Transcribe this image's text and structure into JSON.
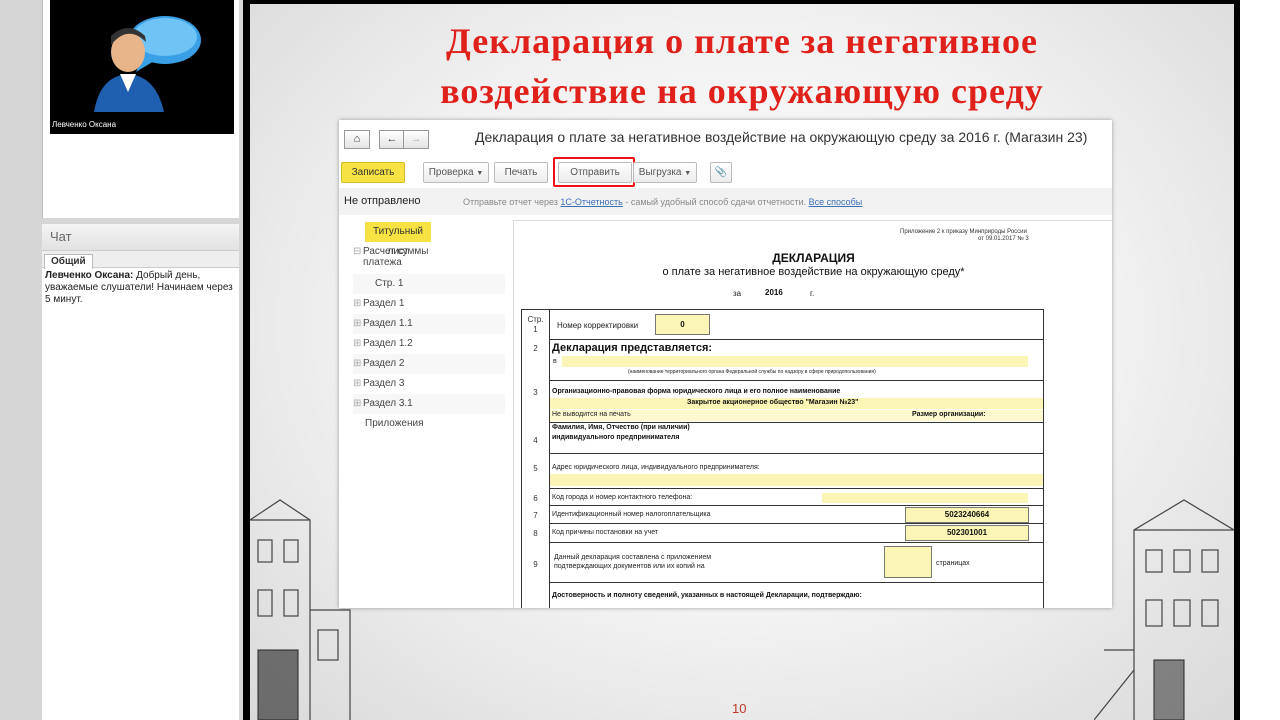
{
  "webinar": {
    "presenter_name": "Левченко Оксана",
    "chat": {
      "title": "Чат",
      "tab": "Общий",
      "message_author": "Левченко Оксана:",
      "message_text": "Добрый день, уважаемые слушатели! Начинаем через 5 минут."
    }
  },
  "slide": {
    "title_line1": "Декларация о плате за негативное",
    "title_line2": "воздействие на окружающую среду",
    "page_number": "10"
  },
  "app": {
    "window_title": "Декларация о плате за негативное воздействие на окружающую среду за 2016 г. (Магазин 23)",
    "toolbar": {
      "save": "Записать",
      "check": "Проверка",
      "print": "Печать",
      "send": "Отправить",
      "export": "Выгрузка",
      "clip_icon": "paperclip-icon"
    },
    "status": {
      "state": "Не отправлено",
      "hint_prefix": "Отправьте отчет через",
      "hint_link": "1С-Отчетность",
      "hint_suffix": "- самый удобный способ сдачи отчетности.",
      "all_methods": "Все способы"
    },
    "sidebar": {
      "title_page": "Титульный лист",
      "calc": "Расчет суммы платежа",
      "page1": "Стр. 1",
      "s1": "Раздел 1",
      "s11": "Раздел 1.1",
      "s12": "Раздел 1.2",
      "s2": "Раздел 2",
      "s3": "Раздел 3",
      "s31": "Раздел 3.1",
      "appendix": "Приложения"
    },
    "doc": {
      "appendix_note_1": "Приложение 2 к приказу Минприроды России",
      "appendix_note_2": "от 09.01.2017 № 3",
      "heading": "ДЕКЛАРАЦИЯ",
      "subheading": "о плате за негативное воздействие на окружающую среду*",
      "year_label": "за",
      "year": "2016",
      "year_suffix": "г.",
      "page_label": "Стр.",
      "row1": "1",
      "correction_label": "Номер корректировки",
      "correction_value": "0",
      "row2": "2",
      "presented_label": "Декларация представляется:",
      "presented_in": "в",
      "org_caption": "(наименование территориального органа Федеральной службы по надзору в сфере природопользования)",
      "row3": "3",
      "legal_form_label": "Организационно-правовая форма юридического лица и его полное наименование",
      "company_name": "Закрытое акционерное общество \"Магазин №23\"",
      "not_printed": "Не выводится на печать",
      "org_size": "Размер организации:",
      "row4": "4",
      "fio_label_1": "Фамилия, Имя, Отчество (при наличии)",
      "fio_label_2": "индивидуального предпринимателя",
      "row5": "5",
      "address_label": "Адрес юридического лица, индивидуального предпринимателя:",
      "row6": "6",
      "phone_label": "Код города и номер контактного телефона:",
      "row7": "7",
      "inn_label": "Идентификационный номер налогоплательщика",
      "inn_value": "5023240664",
      "row8": "8",
      "kpp_label": "Код причины постановки на учет",
      "kpp_value": "502301001",
      "row9": "9",
      "attach_label_1": "Данный декларация составлена с приложением",
      "attach_label_2": "подтверждающих документов или их копий на",
      "pages_label": "страницах",
      "confirm_label": "Достоверность и полноту сведений, указанных в настоящей Декларации, подтверждаю:"
    }
  }
}
